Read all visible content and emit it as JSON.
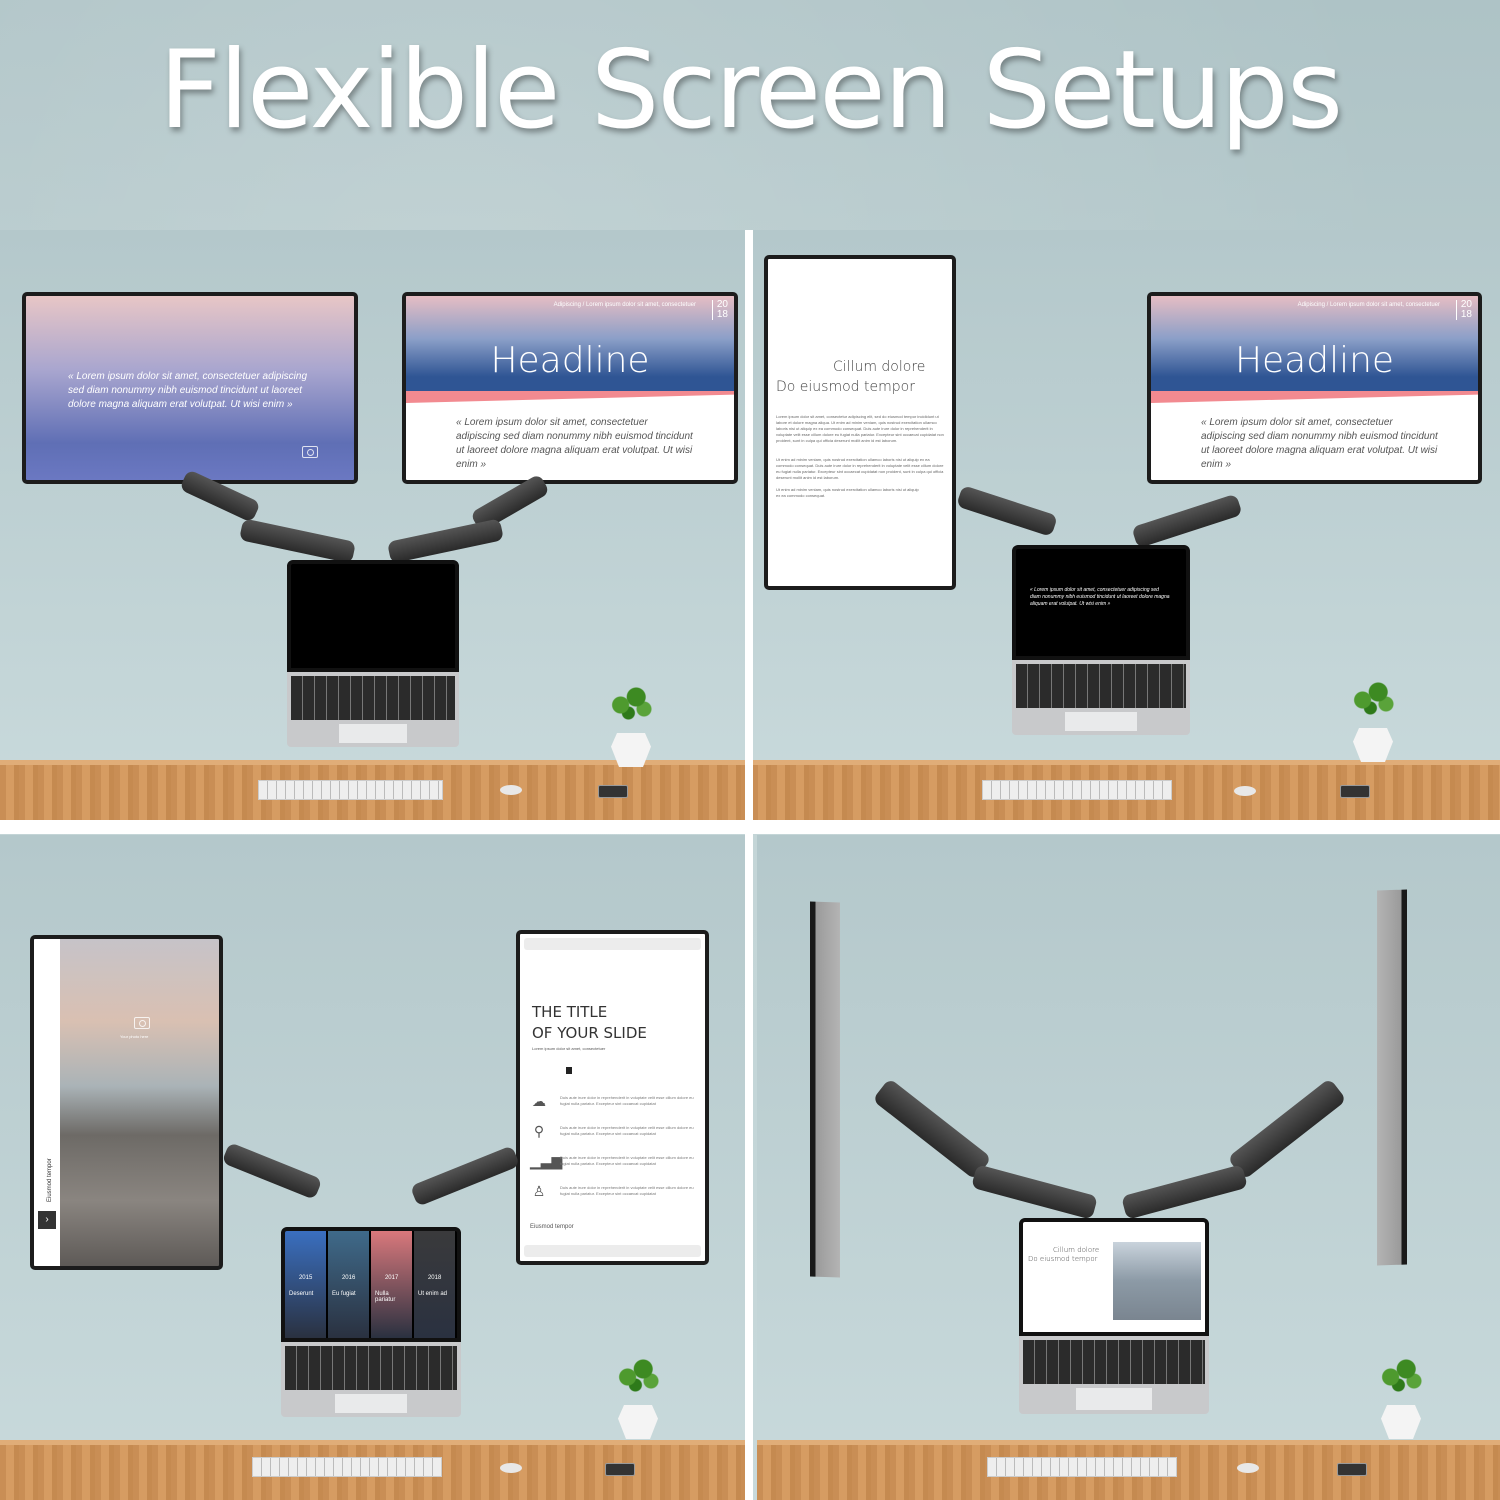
{
  "title": "Flexible Screen Setups",
  "quote_text": "« Lorem ipsum dolor sit amet, consectetuer adipiscing sed diam nonummy nibh euismod tincidunt ut laoreet dolore magna aliquam erat volutpat. Ut wisi enim »",
  "headline_slide": {
    "headline": "Headline",
    "meta": "Adipiscing  /  Lorem ipsum dolor sit amet, consectetuer",
    "year_top": "20",
    "year_bottom": "18",
    "quote": "« Lorem ipsum dolor sit amet, consectetuer adipiscing sed diam nonummy nibh euismod tincidunt ut laoreet dolore magna aliquam erat volutpat. Ut wisi enim »"
  },
  "doc_slide": {
    "line1": "Cillum dolore",
    "line2": "Do eiusmod tempor",
    "para1": "Lorem ipsum dolor sit amet, consectetur adipiscing elit, sed do eiusmod tempor incididunt ut labore et dolore magna aliqua. Ut enim ad minim veniam, quis nostrud exercitation ullamco laboris nisi ut aliquip ex ea commodo consequat. Duis aute irure dolor in reprehenderit in voluptate velit esse cillum dolore eu fugiat nulla pariatur. Excepteur sint occaecat cupidatat non proident, sunt in culpa qui officia deserunt mollit anim id est laborum.",
    "para2": "Ut enim ad minim veniam, quis nostrud exercitation ullamco laboris nisi ut aliquip ex ea commodo consequat. Duis aute irure dolor in reprehenderit in voluptate velit esse cillum dolore eu fugiat nulla pariatur. Excepteur sint occaecat cupidatat non proident, sunt in culpa qui officia deserunt mollit anim id est laborum.",
    "para3": "Ut enim ad minim veniam, quis nostrud exercitation ullamco laboris nisi ut aliquip ex ea commodo consequat."
  },
  "photo_slide": {
    "side_label": "Eiusmod tempor",
    "photo_caption": "Your photo here"
  },
  "title_slide": {
    "title_line1": "THE TITLE",
    "title_line2": "OF YOUR SLIDE",
    "subtitle": "Lorem ipsum dolor sit amet, consectetuer",
    "features": [
      {
        "icon": "cloud-icon",
        "glyph": "☁",
        "text": "Duis aute irure dolor in reprehenderit in voluptate velit esse cillum dolore eu fugiat nulla pariatur. Excepteur sint occaecat cupidatat"
      },
      {
        "icon": "growth-icon",
        "glyph": "⚲",
        "text": "Duis aute irure dolor in reprehenderit in voluptate velit esse cillum dolore eu fugiat nulla pariatur. Excepteur sint occaecat cupidatat"
      },
      {
        "icon": "bar-chart-icon",
        "glyph": "▁▃▆",
        "text": "Duis aute irure dolor in reprehenderit in voluptate velit esse cillum dolore eu fugiat nulla pariatur. Excepteur sint occaecat cupidatat"
      },
      {
        "icon": "user-icon",
        "glyph": "♙",
        "text": "Duis aute irure dolor in reprehenderit in voluptate velit esse cillum dolore eu fugiat nulla pariatur. Excepteur sint occaecat cupidatat"
      }
    ],
    "footer": "Eiusmod tempor"
  },
  "timeline_slide": {
    "columns": [
      {
        "year": "2015",
        "label": "Deserunt",
        "color": "#3a6fc0"
      },
      {
        "year": "2016",
        "label": "Eu fugiat",
        "color": "#3f6a8a"
      },
      {
        "year": "2017",
        "label": "Nulla pariatur",
        "color": "#d9787c"
      },
      {
        "year": "2018",
        "label": "Ut enim ad",
        "color": "#3a3a3c"
      }
    ]
  },
  "colors": {
    "wall": "#b9cccf",
    "desk": "#cf955a",
    "headline_blue": "#2f5594",
    "accent_pink": "#f28a90"
  }
}
